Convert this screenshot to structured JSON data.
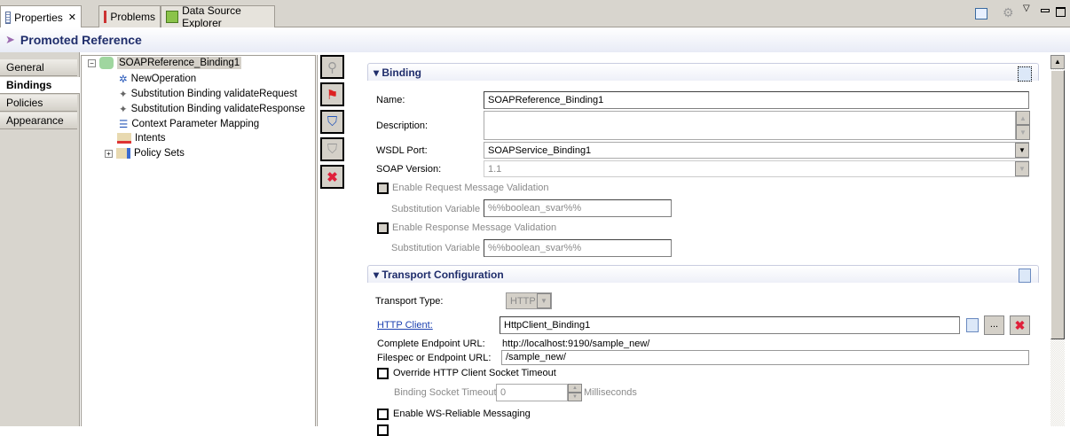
{
  "tabs": [
    {
      "label": "Properties",
      "active": true
    },
    {
      "label": "Problems"
    },
    {
      "label": "Data Source Explorer"
    }
  ],
  "header": {
    "title": "Promoted Reference"
  },
  "left_tabs": [
    "General",
    "Bindings",
    "Policies",
    "Appearance"
  ],
  "tree": {
    "root": "SOAPReference_Binding1",
    "children": [
      "NewOperation",
      "Substitution Binding validateRequest",
      "Substitution Binding validateResponse",
      "Context Parameter Mapping",
      "Intents",
      "Policy Sets"
    ]
  },
  "binding": {
    "title": "Binding",
    "name_label": "Name:",
    "name_value": "SOAPReference_Binding1",
    "description_label": "Description:",
    "description_value": "",
    "wsdl_label": "WSDL Port:",
    "wsdl_value": "SOAPService_Binding1",
    "soap_label": "SOAP Version:",
    "soap_value": "1.1",
    "req_validation": "Enable Request Message Validation",
    "resp_validation": "Enable Response Message Validation",
    "subst_label": "Substitution Variable",
    "subst_value1": "%%boolean_svar%%",
    "subst_value2": "%%boolean_svar%%"
  },
  "transport": {
    "title": "Transport Configuration",
    "type_label": "Transport Type:",
    "type_value": "HTTP",
    "client_label": "HTTP Client:",
    "client_value": "HttpClient_Binding1",
    "browse": "...",
    "endpoint_label": "Complete Endpoint URL:",
    "endpoint_value": "http://localhost:9190/sample_new/",
    "filespec_label": "Filespec or Endpoint URL:",
    "filespec_value": "/sample_new/",
    "override_label": "Override HTTP Client Socket Timeout",
    "timeout_label": "Binding Socket Timeout",
    "timeout_value": "0",
    "timeout_unit": "Milliseconds",
    "wsrm_label": "Enable WS-Reliable Messaging"
  }
}
